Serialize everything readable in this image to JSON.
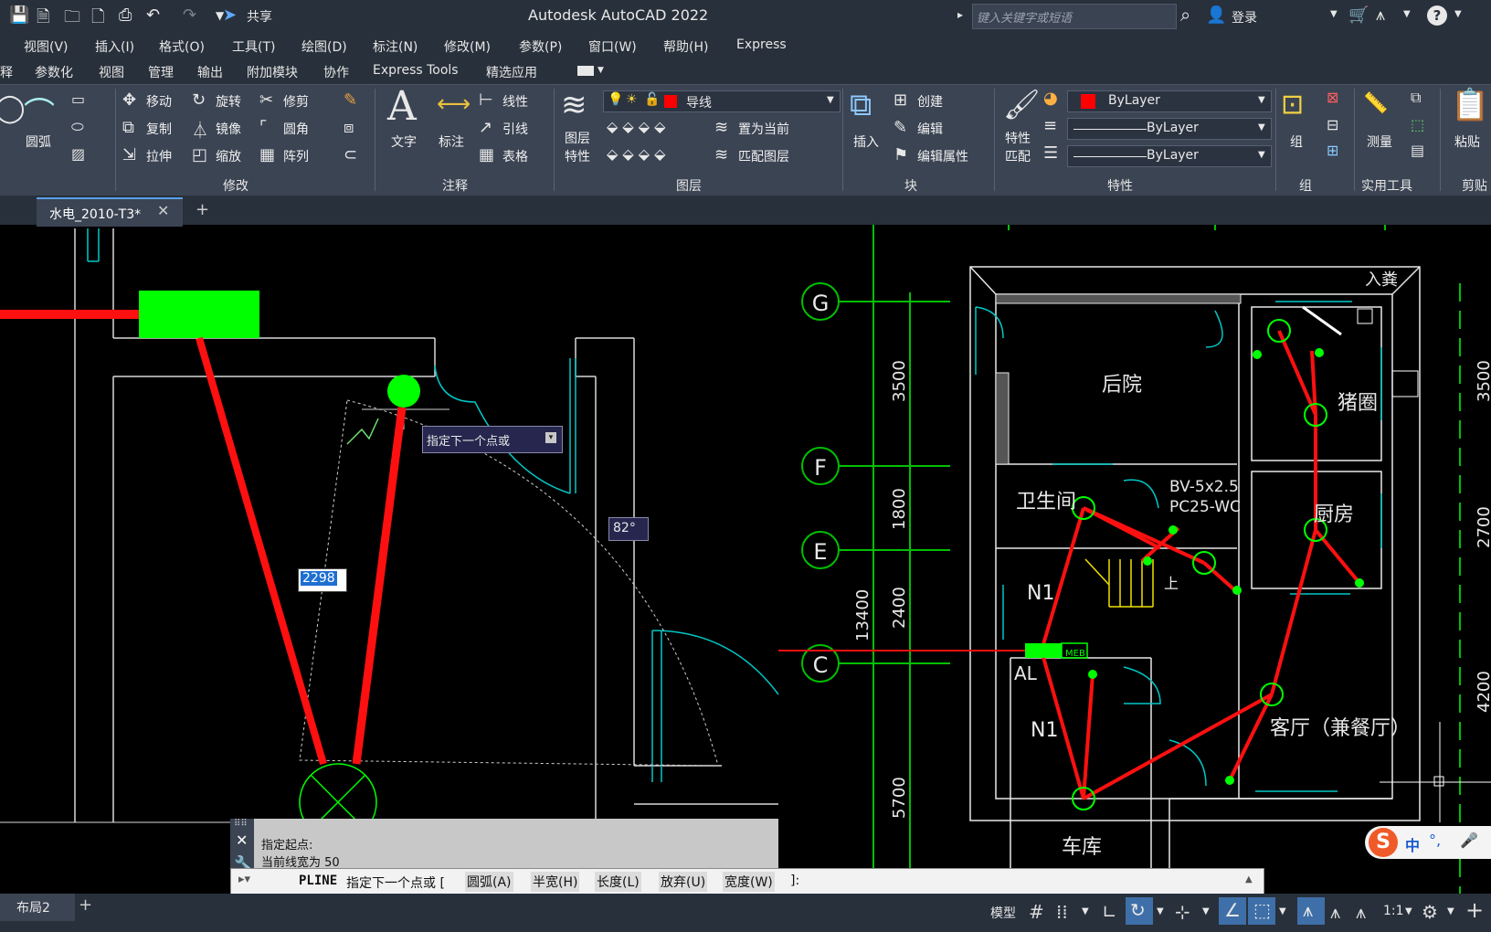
{
  "app": {
    "title": "Autodesk AutoCAD 2022",
    "share_label": "共享",
    "search_placeholder": "键入关键字或短语",
    "login_label": "登录"
  },
  "menu": [
    "视图(V)",
    "插入(I)",
    "格式(O)",
    "工具(T)",
    "绘图(D)",
    "标注(N)",
    "修改(M)",
    "参数(P)",
    "窗口(W)",
    "帮助(H)",
    "Express"
  ],
  "ribbon_tabs": [
    "释",
    "参数化",
    "视图",
    "管理",
    "输出",
    "附加模块",
    "协作",
    "Express Tools",
    "精选应用"
  ],
  "ribbon": {
    "draw": {
      "arc": "圆弧"
    },
    "modify": {
      "move": "移动",
      "rotate": "旋转",
      "trim": "修剪",
      "copy": "复制",
      "mirror": "镜像",
      "fillet": "圆角",
      "stretch": "拉伸",
      "scale": "缩放",
      "array": "阵列",
      "panel": "修改"
    },
    "annotation": {
      "text": "文字",
      "dimension": "标注",
      "linear": "线性",
      "leader": "引线",
      "table": "表格",
      "panel": "注释"
    },
    "layers": {
      "props_line1": "图层",
      "props_line2": "特性",
      "current_layer": "导线",
      "set_current": "置为当前",
      "match": "匹配图层",
      "panel": "图层"
    },
    "block": {
      "insert": "插入",
      "create": "创建",
      "edit": "编辑",
      "edit_attr": "编辑属性",
      "panel": "块"
    },
    "properties": {
      "match_line1": "特性",
      "match_line2": "匹配",
      "color": "ByLayer",
      "linetype": "ByLayer",
      "lineweight": "ByLayer",
      "panel": "特性"
    },
    "groups": {
      "group": "组",
      "panel": "组"
    },
    "utilities": {
      "measure": "测量",
      "panel": "实用工具"
    },
    "clipboard": {
      "paste": "粘贴",
      "panel": "剪贴"
    }
  },
  "doc_tab": {
    "name": "水电_2010-T3*"
  },
  "drawing": {
    "prompt_tooltip": "指定下一个点或",
    "length_input": "2298",
    "angle_tooltip": "82°",
    "grid_labels": [
      "G",
      "F",
      "E",
      "C"
    ],
    "dims": [
      "3500",
      "1800",
      "2400",
      "5700",
      "13400"
    ],
    "dims_right": [
      "3500",
      "2700",
      "4200"
    ],
    "rooms": [
      "后院",
      "猪圈",
      "卫生间",
      "厨房",
      "客厅（兼餐厅）",
      "车库",
      "N1",
      "N1",
      "AL"
    ],
    "cable_label_1": "BV-5x2.5",
    "cable_label_2": "PC25-WC",
    "entry_label": "入粪",
    "stair_label": "上",
    "panel_label": "MEB"
  },
  "command": {
    "history": [
      "指定起点:",
      "当前线宽为 50"
    ],
    "current_cmd": "PLINE",
    "current_text": "指定下一个点或 [",
    "options": [
      "圆弧(A)",
      "半宽(H)",
      "长度(L)",
      "放弃(U)",
      "宽度(W)"
    ],
    "suffix": "]:"
  },
  "status": {
    "layout_tab": "布局2",
    "model_label": "模型",
    "scale": "1:1"
  },
  "ime": {
    "label": "中"
  },
  "colors": {
    "red": "#ff1010",
    "green": "#00ff00",
    "cyan": "#00c8c8",
    "yellow": "#f0e000",
    "ribbon_bg": "#3b4453",
    "title_bg": "#28303b"
  }
}
